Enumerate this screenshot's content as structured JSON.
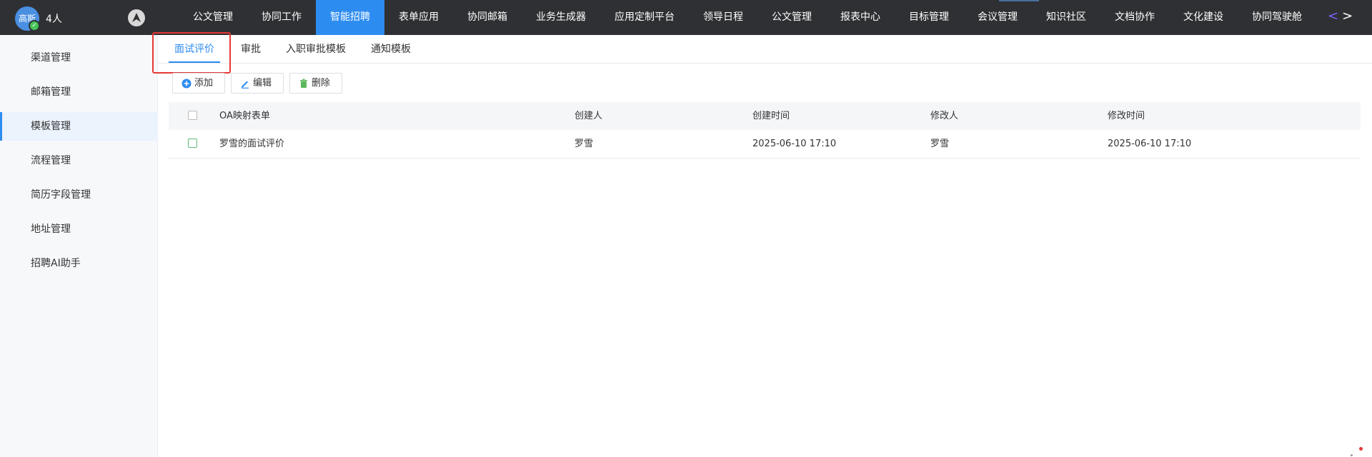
{
  "user": {
    "avatar_text": "高斯",
    "people_count": "4人"
  },
  "topnav": {
    "items": [
      "公文管理",
      "协同工作",
      "智能招聘",
      "表单应用",
      "协同邮箱",
      "业务生成器",
      "应用定制平台",
      "领导日程",
      "公文管理",
      "报表中心",
      "目标管理",
      "会议管理",
      "知识社区",
      "文档协作",
      "文化建设",
      "协同驾驶舱"
    ],
    "active_index": 2
  },
  "sidebar": {
    "items": [
      "渠道管理",
      "邮箱管理",
      "模板管理",
      "流程管理",
      "简历字段管理",
      "地址管理",
      "招聘AI助手"
    ],
    "active_index": 2
  },
  "tabs": {
    "items": [
      "面试评价",
      "审批",
      "入职审批模板",
      "通知模板"
    ],
    "active_index": 0
  },
  "toolbar": {
    "add_label": "添加",
    "edit_label": "编辑",
    "delete_label": "删除"
  },
  "table": {
    "columns": [
      "OA映射表单",
      "创建人",
      "创建时间",
      "修改人",
      "修改时间"
    ],
    "rows": [
      [
        "罗雪的面试评价",
        "罗雪",
        "2025-06-10 17:10",
        "罗雪",
        "2025-06-10 17:10"
      ]
    ]
  },
  "colors": {
    "accent": "#2d8cf0",
    "topbar": "#2f3033",
    "highlight": "#e53935"
  }
}
